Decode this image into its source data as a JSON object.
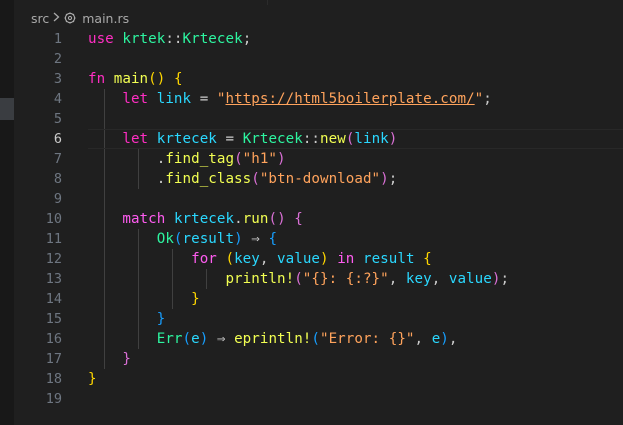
{
  "breadcrumb": {
    "folder": "src",
    "separator": ">",
    "file": "main.rs",
    "file_icon": "rust-file-icon"
  },
  "editor": {
    "current_line": 6,
    "lines": [
      {
        "n": "1"
      },
      {
        "n": "2"
      },
      {
        "n": "3"
      },
      {
        "n": "4"
      },
      {
        "n": "5"
      },
      {
        "n": "6"
      },
      {
        "n": "7"
      },
      {
        "n": "8"
      },
      {
        "n": "9"
      },
      {
        "n": "10"
      },
      {
        "n": "11"
      },
      {
        "n": "12"
      },
      {
        "n": "13"
      },
      {
        "n": "14"
      },
      {
        "n": "15"
      },
      {
        "n": "16"
      },
      {
        "n": "17"
      },
      {
        "n": "18"
      },
      {
        "n": "19"
      }
    ],
    "tokens": {
      "use": "use",
      "krtek": "krtek",
      "path_sep": "::",
      "Krtecek": "Krtecek",
      "semicolon": ";",
      "fn": "fn",
      "main": "main",
      "paren_open": "(",
      "paren_close": ")",
      "brace_open": "{",
      "brace_close": "}",
      "let": "let",
      "link": "link",
      "eq": "=",
      "quote": "\"",
      "url": "https://html5boilerplate.com/",
      "krtecek": "krtecek",
      "new": "new",
      "dot": ".",
      "find_tag": "find_tag",
      "h1_str": "\"h1\"",
      "find_class": "find_class",
      "btn_str": "\"btn-download\"",
      "match": "match",
      "run": "run",
      "Ok": "Ok",
      "result": "result",
      "arrow": "⇒",
      "for": "for",
      "key": "key",
      "comma": ",",
      "value": "value",
      "in": "in",
      "println": "println!",
      "fmt_str": "\"{}: {:?}\"",
      "Err": "Err",
      "e": "e",
      "eprintln": "eprintln!",
      "err_str": "\"Error: {}\""
    }
  },
  "colors": {
    "background": "#1f1f1f",
    "keyword": "#ff2ec3",
    "function": "#f2ff52",
    "type": "#2df5a0",
    "variable": "#2ad8ff",
    "string": "#ffa35c",
    "bracket_1": "#ffd700",
    "bracket_2": "#da70d6",
    "bracket_3": "#179fff"
  }
}
